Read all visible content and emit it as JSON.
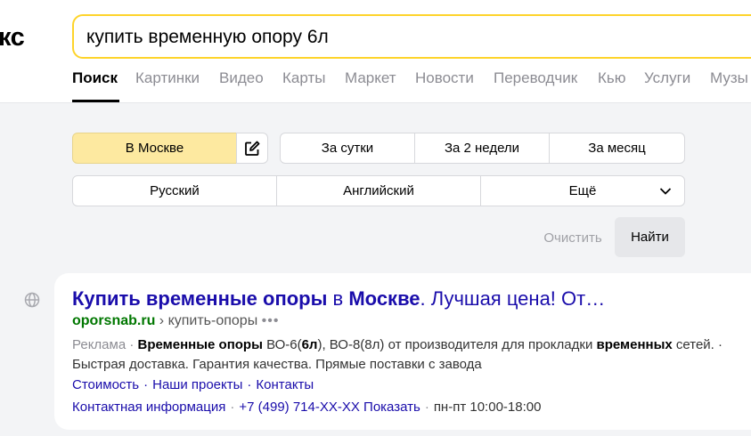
{
  "logo": {
    "text": "кс"
  },
  "search": {
    "query": "купить временную опору 6л"
  },
  "tabs": [
    {
      "label": "Поиск",
      "active": true
    },
    {
      "label": "Картинки"
    },
    {
      "label": "Видео"
    },
    {
      "label": "Карты"
    },
    {
      "label": "Маркет"
    },
    {
      "label": "Новости"
    },
    {
      "label": "Переводчик"
    },
    {
      "label": "Кью"
    },
    {
      "label": "Услуги"
    },
    {
      "label": "Музы"
    }
  ],
  "filters": {
    "region": "В Москве",
    "period": [
      "За сутки",
      "За 2 недели",
      "За месяц"
    ],
    "language": [
      "Русский",
      "Английский",
      "Ещё"
    ],
    "clear": "Очистить",
    "find": "Найти"
  },
  "result": {
    "title": {
      "p1": "Купить временные опоры",
      "p2": " в ",
      "p3": "Москве",
      "p4": ". Лучшая цена! От…"
    },
    "url": {
      "domain": "oporsnab.ru",
      "path": " › купить-опоры",
      "more": "•••"
    },
    "desc": {
      "ad": "Реклама",
      "dot": " · ",
      "b1": "Временные опоры",
      "t1": " ВО-6(",
      "b2": "6л",
      "t2": "), ВО-8(8л) от производителя для прокладки ",
      "b3": "временных",
      "t3": " сетей. · Быстрая доставка. Гарантия качества. Прямые поставки с завода"
    },
    "links": [
      "Стоимость",
      "Наши проекты",
      "Контакты"
    ],
    "contacts": {
      "info": "Контактная информация",
      "phone": "+7 (499) 714-XX-XX Показать",
      "hours": "пн-пт 10:00-18:00"
    }
  }
}
